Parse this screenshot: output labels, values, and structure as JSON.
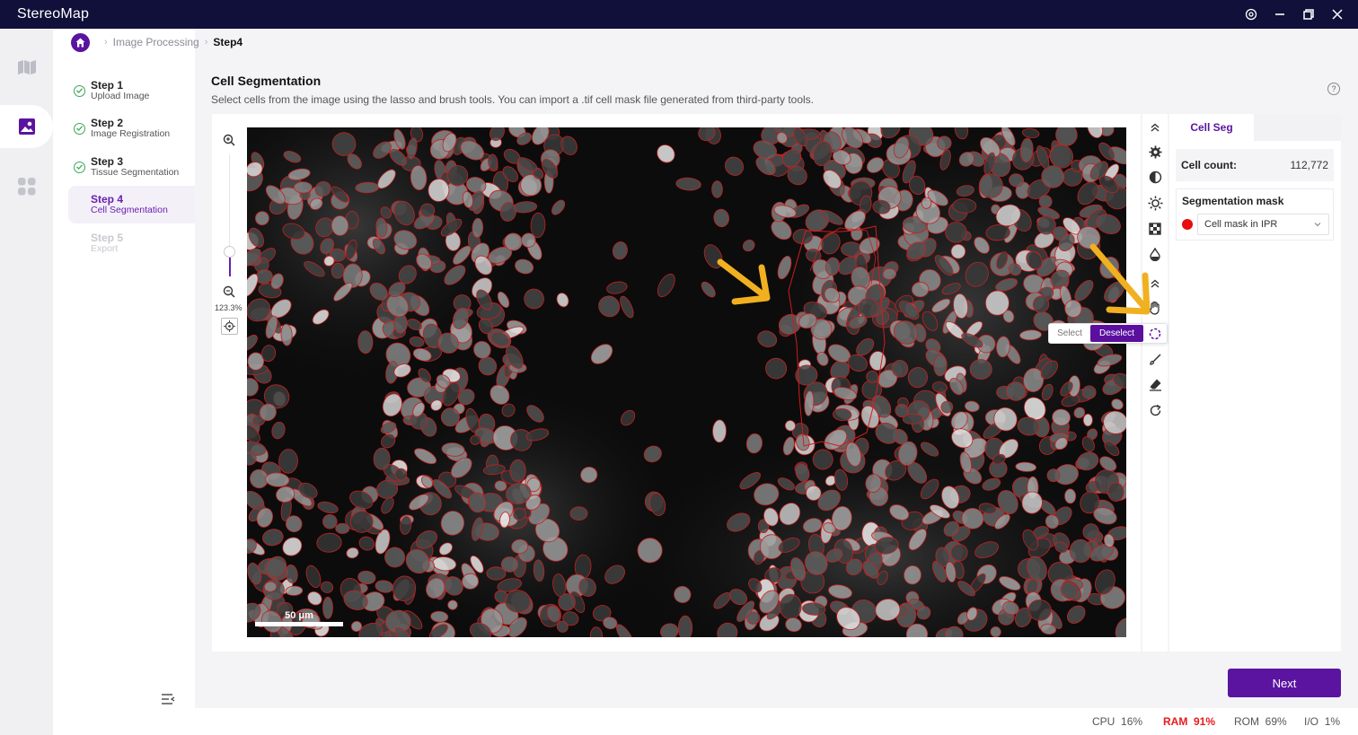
{
  "app": {
    "title": "StereoMap"
  },
  "window_controls": [
    "settings-icon",
    "minimize-icon",
    "restore-icon",
    "close-icon"
  ],
  "rail": {
    "items": [
      "map-icon",
      "image-icon",
      "apps-icon"
    ],
    "active": 1
  },
  "breadcrumb": {
    "items": [
      "Image Processing",
      "Step4"
    ]
  },
  "steps": [
    {
      "label": "Step 1",
      "sub": "Upload Image",
      "state": "done"
    },
    {
      "label": "Step 2",
      "sub": "Image Registration",
      "state": "done"
    },
    {
      "label": "Step 3",
      "sub": "Tissue Segmentation",
      "state": "done"
    },
    {
      "label": "Step 4",
      "sub": "Cell Segmentation",
      "state": "active"
    },
    {
      "label": "Step 5",
      "sub": "Export",
      "state": "disabled"
    }
  ],
  "main": {
    "title": "Cell Segmentation",
    "description": "Select cells from the image using the lasso and brush tools. You can import a .tif cell mask file generated from third-party tools."
  },
  "zoom": {
    "percent": "123.3%",
    "level": 0.2
  },
  "image": {
    "scalebar": "50 μm"
  },
  "tools": [
    "chevrons-up-icon",
    "settings-gear-icon",
    "contrast-icon",
    "brightness-icon",
    "checker-icon",
    "drop-icon",
    "chevrons-up-icon",
    "hand-icon",
    "lasso-icon",
    "brush-icon",
    "eraser-icon",
    "redo-icon"
  ],
  "lasso_popup": {
    "select": "Select",
    "deselect": "Deselect",
    "active": "deselect"
  },
  "right_panel": {
    "tab": "Cell Seg",
    "cell_count_label": "Cell count:",
    "cell_count": "112,772",
    "mask_title": "Segmentation mask",
    "mask_value": "Cell mask in IPR",
    "mask_color": "#e80c0c"
  },
  "next_label": "Next",
  "status": {
    "cpu_label": "CPU",
    "cpu": "16%",
    "ram_label": "RAM",
    "ram": "91%",
    "rom_label": "ROM",
    "rom": "69%",
    "io_label": "I/O",
    "io": "1%"
  },
  "colors": {
    "accent": "#5a14a0",
    "titlebar": "#10103a",
    "warning": "#e81a1a",
    "arrow": "#f0b020"
  }
}
